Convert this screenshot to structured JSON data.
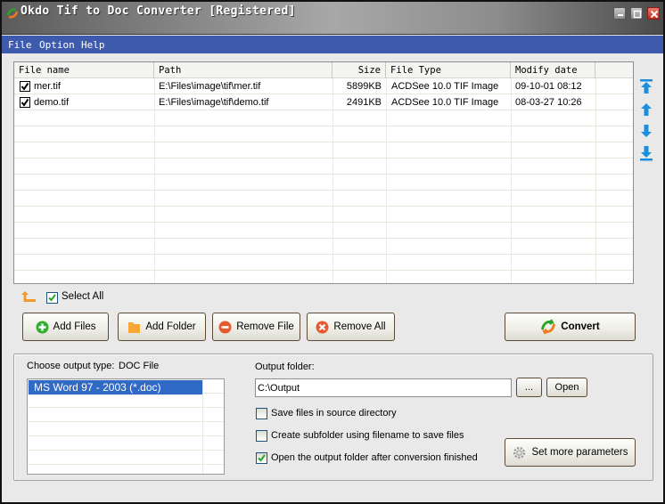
{
  "window": {
    "title": "Okdo Tif to Doc Converter [Registered]",
    "controls": [
      "minimize",
      "maximize",
      "close"
    ]
  },
  "menu": {
    "items": [
      {
        "label": "File"
      },
      {
        "label": "Option"
      },
      {
        "label": "Help"
      }
    ]
  },
  "file_list": {
    "columns": [
      {
        "label": "File name"
      },
      {
        "label": "Path"
      },
      {
        "label": "Size"
      },
      {
        "label": "File Type"
      },
      {
        "label": "Modify date"
      }
    ],
    "rows": [
      {
        "checked": true,
        "name": "mer.tif",
        "path": "E:\\Files\\image\\tif\\mer.tif",
        "size": "5899KB",
        "type": "ACDSee 10.0 TIF Image",
        "date": "09-10-01 08:12"
      },
      {
        "checked": true,
        "name": "demo.tif",
        "path": "E:\\Files\\image\\tif\\demo.tif",
        "size": "2491KB",
        "type": "ACDSee 10.0 TIF Image",
        "date": "08-03-27 10:26"
      }
    ]
  },
  "move_buttons": [
    {
      "icon": "move-top-icon"
    },
    {
      "icon": "move-up-icon"
    },
    {
      "icon": "move-down-icon"
    },
    {
      "icon": "move-bottom-icon"
    }
  ],
  "select_all": {
    "label": "Select All",
    "checked": true
  },
  "actions": {
    "add_files": "Add Files",
    "add_folder": "Add Folder",
    "remove_file": "Remove File",
    "remove_all": "Remove All",
    "convert": "Convert"
  },
  "output": {
    "type_label": "Choose output type:",
    "type_value": "DOC File",
    "types": [
      "MS Word 97 - 2003 (*.doc)"
    ],
    "selected_type": "MS Word 97 - 2003 (*.doc)",
    "folder_label": "Output folder:",
    "folder_value": "C:\\Output",
    "browse_label": "...",
    "open_label": "Open",
    "options": [
      {
        "label": "Save files in source directory",
        "checked": false
      },
      {
        "label": "Create subfolder using filename to save files",
        "checked": false
      },
      {
        "label": "Open the output folder after conversion finished",
        "checked": true
      }
    ],
    "more_params_label": "Set more parameters"
  },
  "colors": {
    "menubar": "#3d5aac",
    "selection": "#3169c6",
    "arrow_blue": "#1a8fe0",
    "check_green": "#2aa52a"
  }
}
